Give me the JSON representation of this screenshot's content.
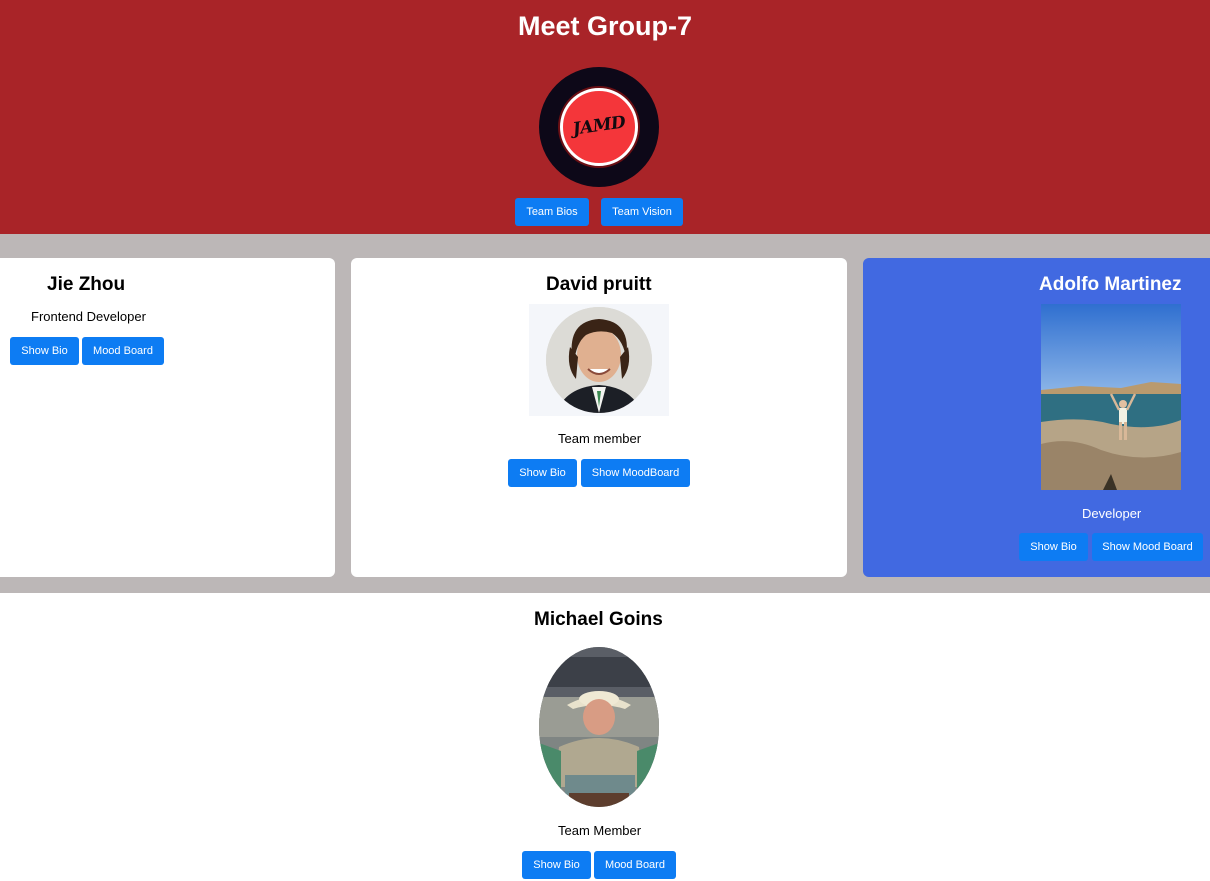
{
  "header": {
    "title": "Meet Group-7",
    "logo_text": "JAMD",
    "buttons": {
      "team_bios": "Team Bios",
      "team_vision": "Team Vision"
    }
  },
  "members": [
    {
      "name": "Jie Zhou",
      "role": "Frontend Developer",
      "bio_button": "Show Bio",
      "mood_button": "Mood Board"
    },
    {
      "name": "David pruitt",
      "role": "Team member",
      "bio_button": "Show Bio",
      "mood_button": "Show MoodBoard"
    },
    {
      "name": "Adolfo Martinez",
      "role": "Developer",
      "bio_button": "Show Bio",
      "mood_button": "Show Mood Board"
    },
    {
      "name": "Michael Goins",
      "role": "Team Member",
      "bio_button": "Show Bio",
      "mood_button": "Mood Board"
    }
  ],
  "colors": {
    "header_bg": "#a92428",
    "strip_bg": "#bcb7b7",
    "button_bg": "#0d7cf3",
    "adolfo_card_bg": "#4169e1"
  },
  "icons": [
    "team-logo-icon"
  ]
}
